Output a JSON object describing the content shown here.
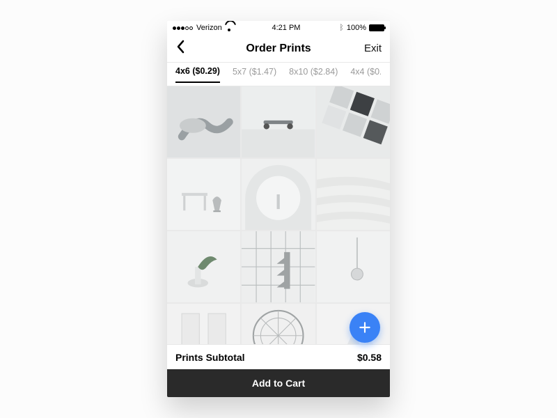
{
  "status": {
    "carrier": "Verizon",
    "time": "4:21 PM",
    "battery": "100%"
  },
  "nav": {
    "title": "Order Prints",
    "exit": "Exit"
  },
  "tabs": [
    {
      "label": "4x6 ($0.29)",
      "active": true
    },
    {
      "label": "5x7 ($1.47)",
      "active": false
    },
    {
      "label": "8x10 ($2.84)",
      "active": false
    },
    {
      "label": "4x4 ($0.",
      "active": false
    }
  ],
  "photos": [
    {
      "motif": "hands"
    },
    {
      "motif": "skateboard"
    },
    {
      "motif": "geometric-tiles"
    },
    {
      "motif": "desk-chair"
    },
    {
      "motif": "arch"
    },
    {
      "motif": "sand"
    },
    {
      "motif": "plant-vase"
    },
    {
      "motif": "building-facade"
    },
    {
      "motif": "pendulum"
    },
    {
      "motif": "open-doors"
    },
    {
      "motif": "ferris-wheel"
    },
    {
      "motif": "pyramids"
    }
  ],
  "footer": {
    "subtotal_label": "Prints Subtotal",
    "subtotal_value": "$0.58",
    "cta": "Add to Cart"
  }
}
